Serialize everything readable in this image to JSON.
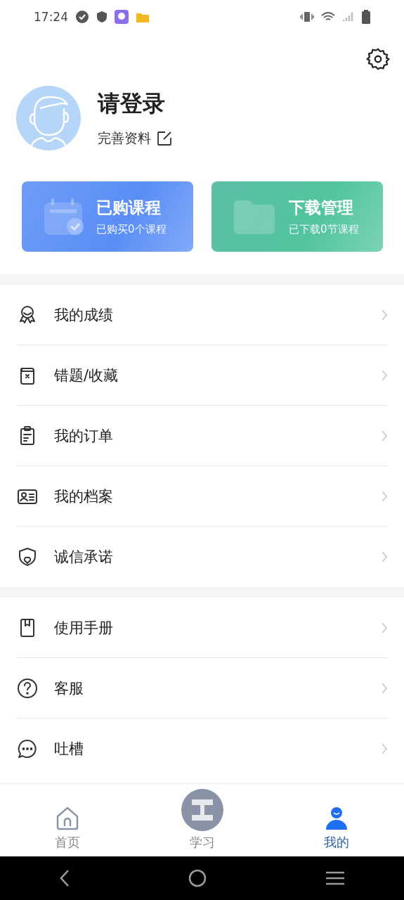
{
  "status_bar": {
    "time": "17:24"
  },
  "profile": {
    "name": "请登录",
    "subtitle": "完善资料"
  },
  "cards": [
    {
      "title": "已购课程",
      "subtitle": "已购买0个课程",
      "kind": "courses"
    },
    {
      "title": "下载管理",
      "subtitle": "已下载0节课程",
      "kind": "downloads"
    }
  ],
  "menu_groups": [
    [
      {
        "label": "我的成绩",
        "kind": "medal"
      },
      {
        "label": "错题/收藏",
        "kind": "book"
      },
      {
        "label": "我的订单",
        "kind": "clipboard"
      },
      {
        "label": "我的档案",
        "kind": "idcard"
      },
      {
        "label": "诚信承诺",
        "kind": "shield"
      }
    ],
    [
      {
        "label": "使用手册",
        "kind": "manual"
      },
      {
        "label": "客服",
        "kind": "help"
      },
      {
        "label": "吐槽",
        "kind": "chat"
      }
    ]
  ],
  "tabs": [
    {
      "label": "首页",
      "kind": "home",
      "selected": false
    },
    {
      "label": "学习",
      "kind": "study",
      "selected": false
    },
    {
      "label": "我的",
      "kind": "me",
      "selected": true
    }
  ]
}
